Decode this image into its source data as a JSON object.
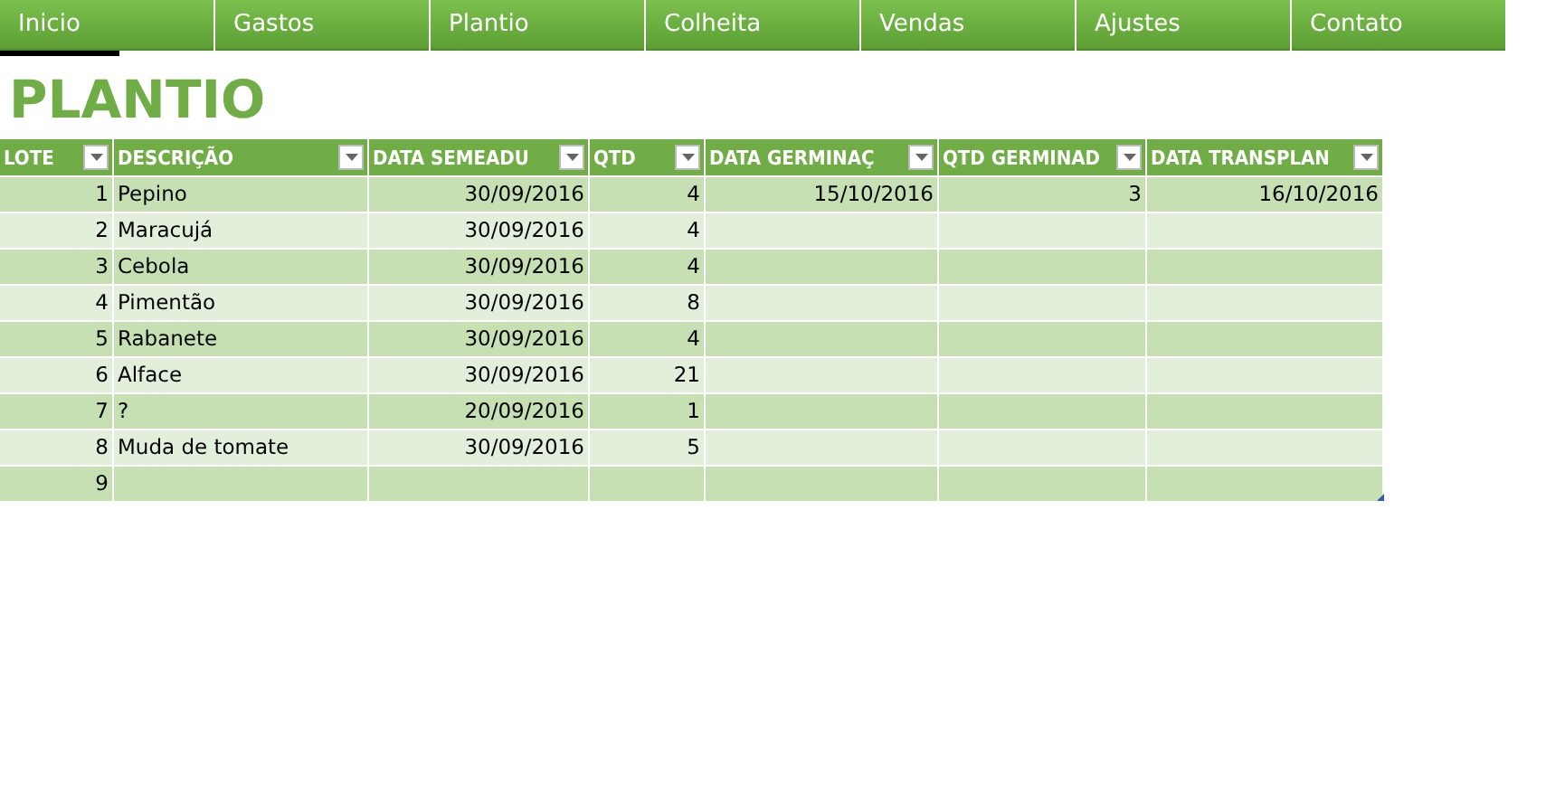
{
  "nav": [
    {
      "label": "Inicio"
    },
    {
      "label": "Gastos"
    },
    {
      "label": "Plantio"
    },
    {
      "label": "Colheita"
    },
    {
      "label": "Vendas"
    },
    {
      "label": "Ajustes"
    },
    {
      "label": "Contato"
    }
  ],
  "title": "PLANTIO",
  "table": {
    "columns": [
      {
        "label": "LOTE",
        "kind": "number"
      },
      {
        "label": "DESCRIÇÃO",
        "kind": "text"
      },
      {
        "label": "DATA SEMEADU",
        "kind": "number"
      },
      {
        "label": "QTD",
        "kind": "number"
      },
      {
        "label": "DATA GERMINAÇ",
        "kind": "number"
      },
      {
        "label": "QTD GERMINAD",
        "kind": "number"
      },
      {
        "label": "DATA TRANSPLAN",
        "kind": "number"
      }
    ],
    "rows": [
      {
        "cells": [
          "1",
          "Pepino",
          "30/09/2016",
          "4",
          "15/10/2016",
          "3",
          "16/10/2016"
        ]
      },
      {
        "cells": [
          "2",
          "Maracujá",
          "30/09/2016",
          "4"
        ]
      },
      {
        "cells": [
          "3",
          "Cebola",
          "30/09/2016",
          "4"
        ]
      },
      {
        "cells": [
          "4",
          "Pimentão",
          "30/09/2016",
          "8"
        ]
      },
      {
        "cells": [
          "5",
          "Rabanete",
          "30/09/2016",
          "4"
        ]
      },
      {
        "cells": [
          "6",
          "Alface",
          "30/09/2016",
          "21"
        ]
      },
      {
        "cells": [
          "7",
          "?",
          "20/09/2016",
          "1"
        ]
      },
      {
        "cells": [
          "8",
          "Muda de tomate",
          "30/09/2016",
          "5"
        ]
      },
      {
        "cells": [
          "9"
        ]
      }
    ]
  }
}
